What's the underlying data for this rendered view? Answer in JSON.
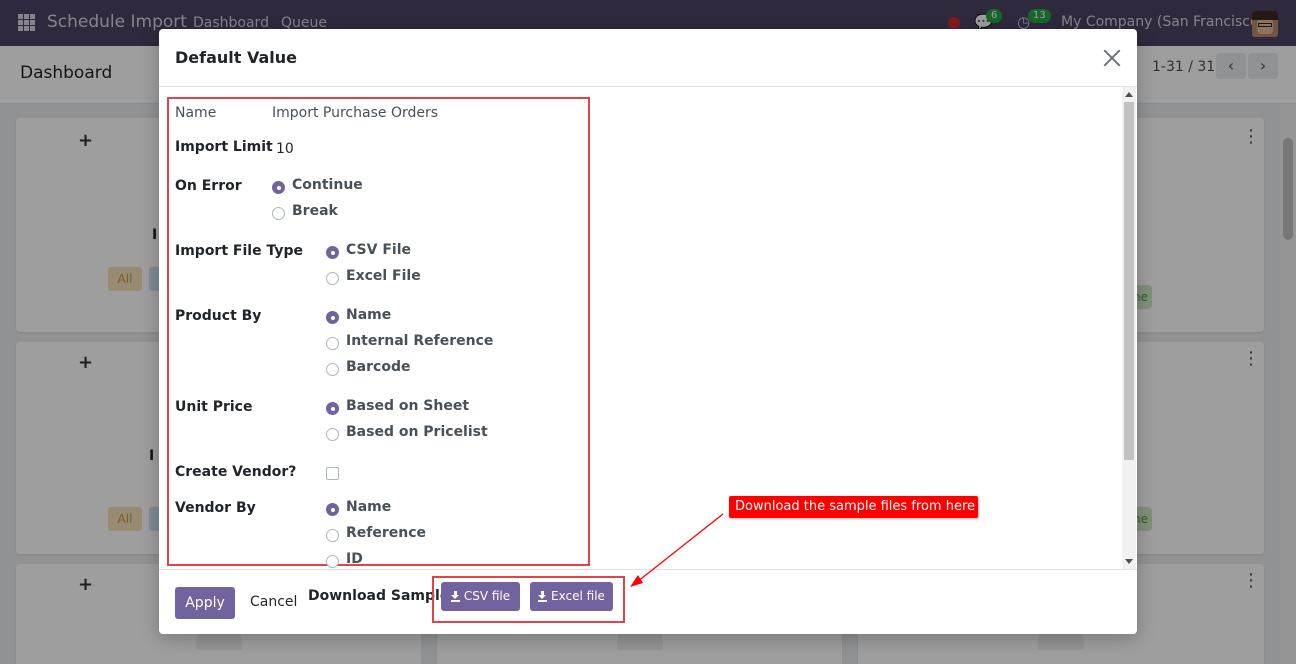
{
  "navbar": {
    "app_name": "Schedule Import",
    "links": [
      "Dashboard",
      "Queue"
    ],
    "messages_count": "6",
    "activities_count": "13",
    "company": "My Company (San Francisco)"
  },
  "control_panel": {
    "title": "Dashboard",
    "pager": "1-31 / 31"
  },
  "background_cards": {
    "tag_all": "All",
    "tag_done_fragment": "one",
    "title_fragment_1": "I",
    "title_fragment_2": "I"
  },
  "modal": {
    "title": "Default Value",
    "fields": {
      "name_label": "Name",
      "name_value": "Import Purchase Orders",
      "import_limit_label": "Import Limit",
      "import_limit_value": "10",
      "on_error_label": "On Error",
      "on_error_options": [
        {
          "label": "Continue",
          "checked": true
        },
        {
          "label": "Break",
          "checked": false
        }
      ],
      "import_file_type_label": "Import File Type",
      "import_file_type_options": [
        {
          "label": "CSV File",
          "checked": true
        },
        {
          "label": "Excel File",
          "checked": false
        }
      ],
      "product_by_label": "Product By",
      "product_by_options": [
        {
          "label": "Name",
          "checked": true
        },
        {
          "label": "Internal Reference",
          "checked": false
        },
        {
          "label": "Barcode",
          "checked": false
        }
      ],
      "unit_price_label": "Unit Price",
      "unit_price_options": [
        {
          "label": "Based on Sheet",
          "checked": true
        },
        {
          "label": "Based on Pricelist",
          "checked": false
        }
      ],
      "create_vendor_label": "Create Vendor?",
      "create_vendor_checked": false,
      "vendor_by_label": "Vendor By",
      "vendor_by_options": [
        {
          "label": "Name",
          "checked": true
        },
        {
          "label": "Reference",
          "checked": false
        },
        {
          "label": "ID",
          "checked": false
        }
      ]
    },
    "footer": {
      "apply_label": "Apply",
      "cancel_label": "Cancel",
      "download_label": "Download Sample:",
      "csv_button": "CSV file",
      "excel_button": "Excel file"
    }
  },
  "annotation": {
    "callout_text": "Download the sample files from here"
  },
  "colors": {
    "navbar": "#4d4363",
    "primary": "#71639e",
    "highlight": "#e0444b",
    "callout": "#ff0000"
  }
}
